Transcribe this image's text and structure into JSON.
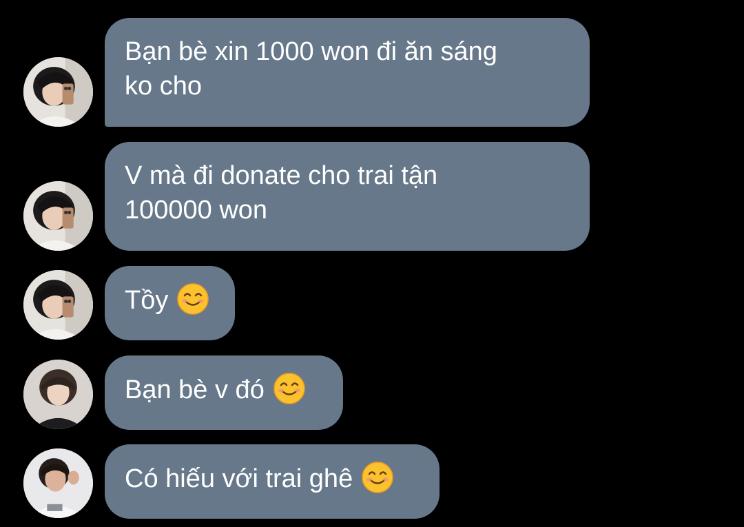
{
  "colors": {
    "background": "#000000",
    "bubble": "#66788a",
    "text": "#ffffff"
  },
  "messages": [
    {
      "avatar": "avatar-girl-mirror-selfie",
      "lines": [
        "Bạn bè xin 1000 won đi ăn sáng",
        "ko cho"
      ],
      "emoji": null
    },
    {
      "avatar": "avatar-girl-mirror-selfie",
      "lines": [
        "V mà đi donate cho trai tận",
        "100000 won"
      ],
      "emoji": null
    },
    {
      "avatar": "avatar-girl-mirror-selfie",
      "lines": [
        "Tồy"
      ],
      "emoji": "smiling-face-emoji"
    },
    {
      "avatar": "avatar-boy-portrait",
      "lines": [
        "Bạn bè v đó"
      ],
      "emoji": "smiling-face-emoji"
    },
    {
      "avatar": "avatar-boy-waving",
      "lines": [
        "Có hiếu với trai ghê"
      ],
      "emoji": "smiling-face-emoji"
    }
  ]
}
